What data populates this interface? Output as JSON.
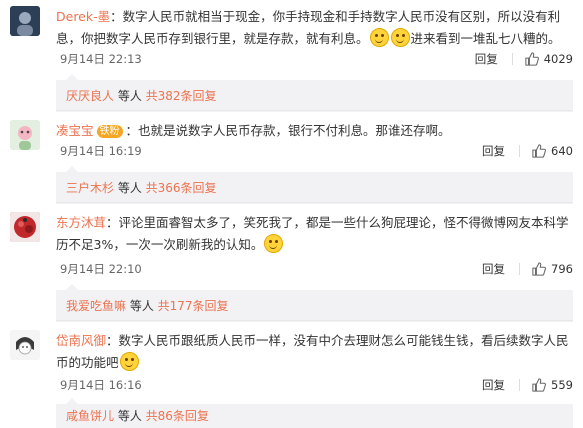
{
  "comments": [
    {
      "username": "Derek-墨",
      "text_part1": "：数字人民币就相当于现金，你手持现金和手持数字人民币没有区别，所以没有利息，你把数字人民币存到银行里，就是存款，就有利息。",
      "text_part2": "进来看到一堆乱七八糟的。",
      "timestamp": "9月14日 22:13",
      "reply_label": "回复",
      "likes": "4029",
      "sub_user": "厌厌良人",
      "sub_mid": " 等人 ",
      "sub_total": "共382条回复",
      "avatar_color": "#5a6f8a"
    },
    {
      "username": "凑宝宝",
      "badge": "铁粉",
      "text_part1": "：也就是说数字人民币存款，银行不付利息。那谁还存啊。",
      "timestamp": "9月14日 16:19",
      "reply_label": "回复",
      "likes": "640",
      "sub_user": "三户木杉",
      "sub_mid": " 等人 ",
      "sub_total": "共366条回复",
      "avatar_color": "#d9e8d4"
    },
    {
      "username": "东方沐茸",
      "text_part1": "：评论里面睿智太多了，笑死我了，都是一些什么狗屁理论，怪不得微博网友本科学历不足3%，一次一次刷新我的认知。",
      "timestamp": "9月14日 22:10",
      "reply_label": "回复",
      "likes": "796",
      "sub_user": "我爱吃鱼嘛",
      "sub_mid": " 等人 ",
      "sub_total": "共177条回复",
      "avatar_color": "#b22a2a"
    },
    {
      "username": "岱南风御",
      "text_part1": "：数字人民币跟纸质人民币一样，没有中介去理财怎么可能钱生钱，看后续数字人民币的功能吧",
      "timestamp": "9月14日 16:16",
      "reply_label": "回复",
      "likes": "559",
      "sub_user": "咸鱼饼儿",
      "sub_mid": " 等人 ",
      "sub_total": "共86条回复",
      "avatar_color": "#e6e6e6"
    }
  ],
  "icons": {
    "like": "thumbs-up-icon",
    "emoji": "smile-emoji-icon"
  },
  "colors": {
    "link": "#eb7350",
    "sub_bg": "#f2f2f5"
  }
}
